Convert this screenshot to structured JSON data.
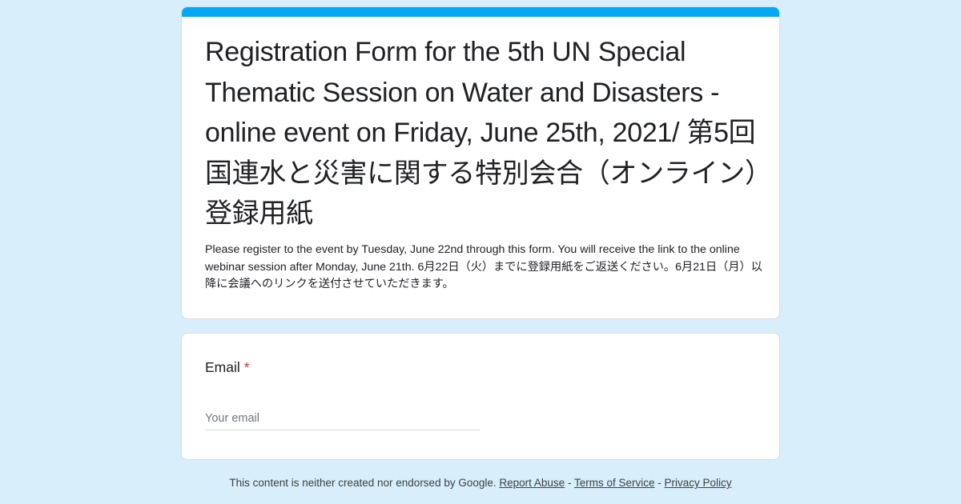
{
  "colors": {
    "background": "#d8eefa",
    "accent": "#03a9f4",
    "required": "#d93025"
  },
  "form": {
    "title": "Registration Form for the 5th UN Special Thematic Session on Water and Disasters - online event on Friday, June 25th, 2021/ 第5回　国連水と災害に関する特別会合（オンライン）登録用紙",
    "description": "Please register to the event by Tuesday, June 22nd through this form.  You will receive the link to the online webinar session after Monday, June 21th. 6月22日（火）までに登録用紙をご返送ください。6月21日（月）以降に会議へのリンクを送付させていただきます。"
  },
  "question": {
    "label": "Email",
    "required_marker": "*",
    "placeholder": "Your email",
    "value": ""
  },
  "footer": {
    "disclaimer": "This content is neither created nor endorsed by Google.",
    "separator": "-",
    "links": [
      {
        "label": "Report Abuse"
      },
      {
        "label": "Terms of Service"
      },
      {
        "label": "Privacy Policy"
      }
    ]
  }
}
